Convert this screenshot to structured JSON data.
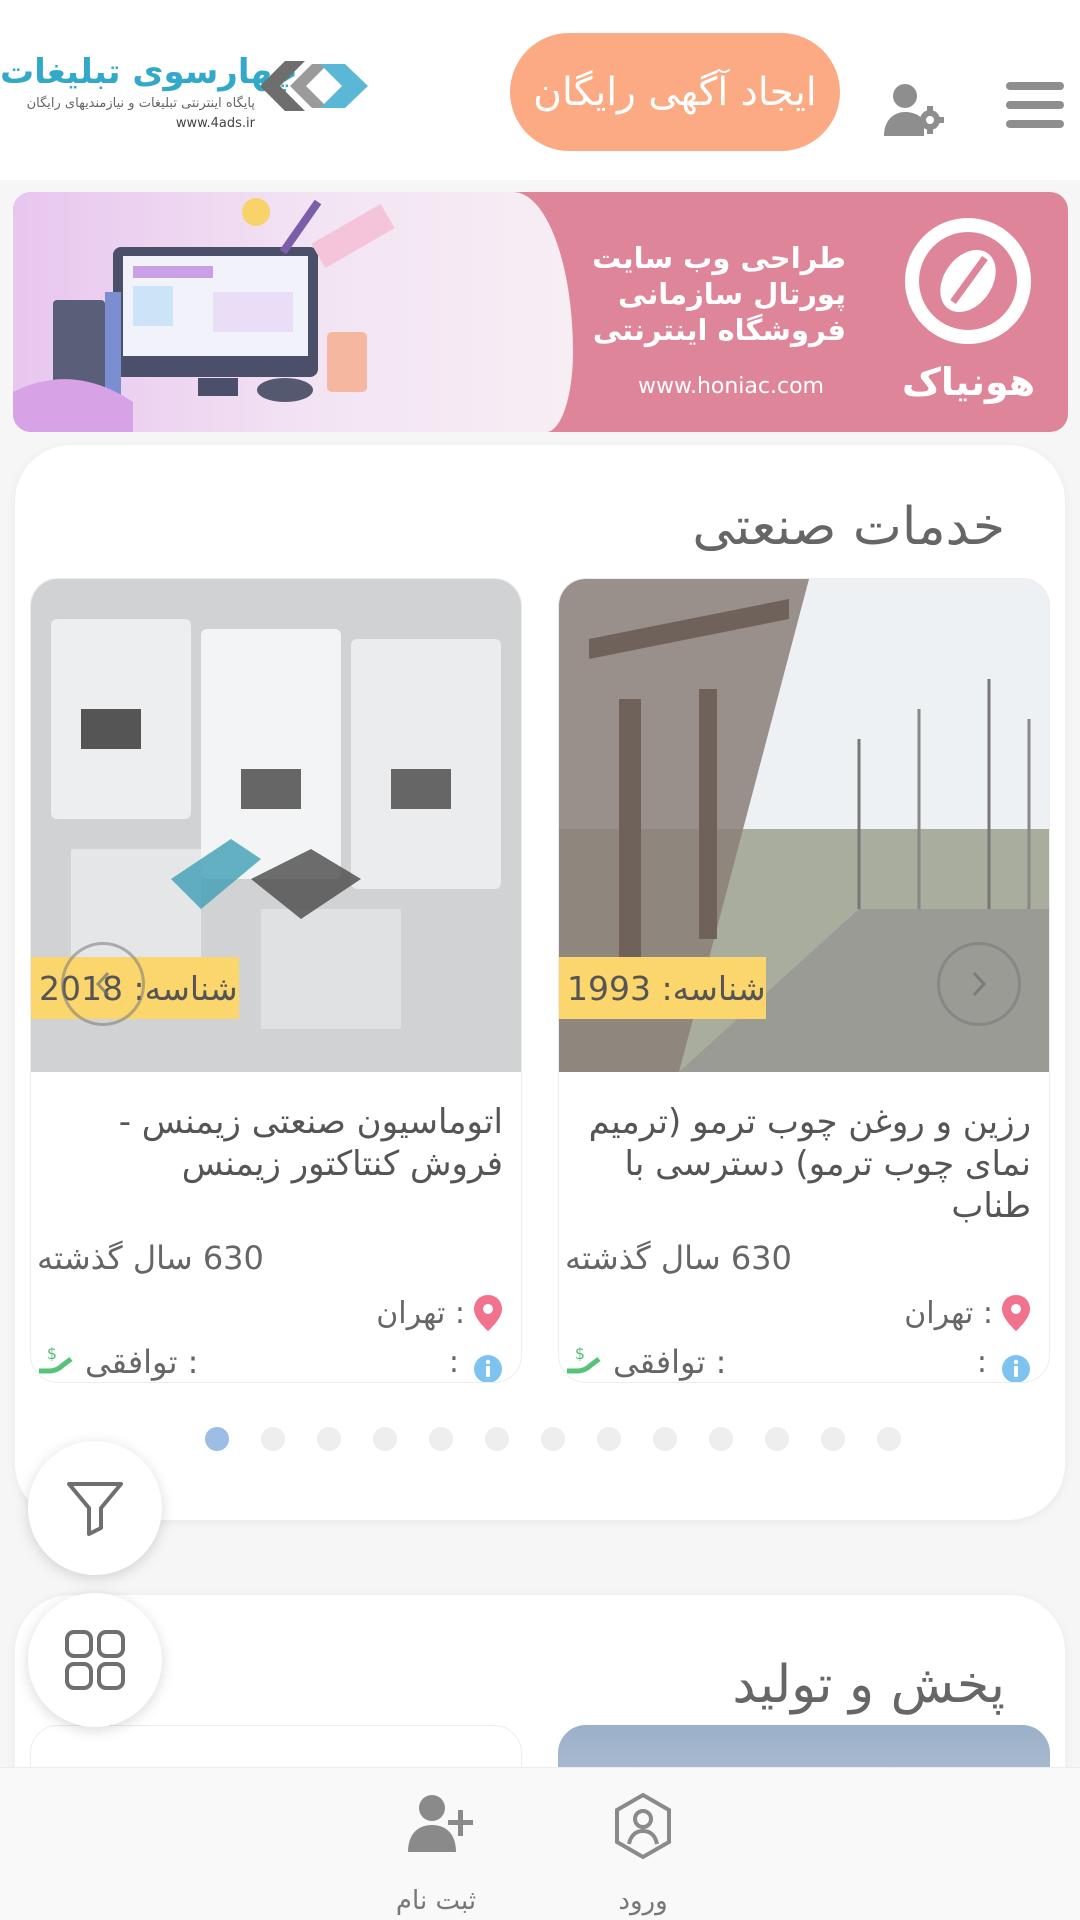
{
  "header": {
    "menu_icon": "hamburger-icon",
    "account_icon": "user-settings-icon",
    "create_ad_label": "ایجاد آگهی رایگان",
    "logo": {
      "title": "چهارسوی تبلیغات",
      "subtitle": "پایگاه اینترنتی تبلیغات و نیازمندیهای رایگان",
      "url": "www.4ads.ir"
    }
  },
  "banner": {
    "lines": [
      "طراحی وب سایت",
      "پورتال سازمانی",
      "فروشگاه اینترنتی"
    ],
    "url": "www.honiac.com",
    "brand": "هونیاک",
    "colors": {
      "background": "#df8599"
    }
  },
  "sections": [
    {
      "title": "خدمات صنعتی",
      "cards": [
        {
          "id_text": "شناسه: 1993",
          "title": "رزین و روغن چوب ترمو (ترمیم نمای چوب ترمو) دسترسی با طناب",
          "age": "630 سال گذشته",
          "city": ": تهران",
          "category": ":",
          "price": ": توافقی"
        },
        {
          "id_text": "شناسه: 2018",
          "title": "اتوماسیون صنعتی زیمنس - فروش کنتاکتور زیمنس",
          "age": "630 سال گذشته",
          "city": ": تهران",
          "category": ":",
          "price": ": توافقی"
        }
      ],
      "carousel": {
        "page_count": 13,
        "active_index": 0
      }
    },
    {
      "title": "پخش و تولید"
    }
  ],
  "fabs": {
    "filter_icon": "filter-icon",
    "grid_icon": "grid-icon"
  },
  "bottom_nav": {
    "login_label": "ورود",
    "register_label": "ثبت نام"
  },
  "colors": {
    "accent": "#fbaa84",
    "badge": "#fad66d",
    "dot_active": "#9bbde6",
    "location_pin": "#f1728c",
    "price_icon": "#57c27a",
    "info_icon": "#7cc4ef"
  }
}
